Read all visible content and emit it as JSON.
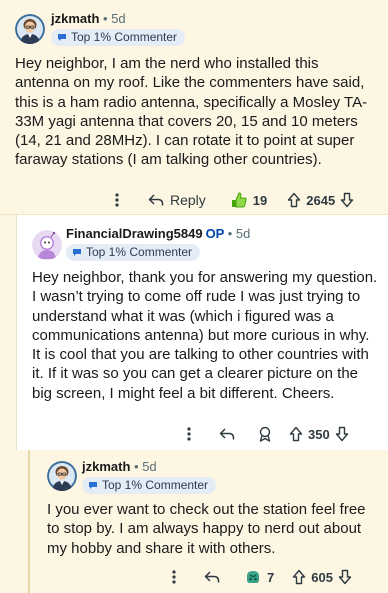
{
  "comments": [
    {
      "author": "jzkmath",
      "age": "• 5d",
      "flair": "Top 1% Commenter",
      "body": "Hey neighbor, I am the nerd who installed this antenna on my roof. Like the commenters have said, this is a ham radio antenna, specifically a Mosley TA-33M yagi antenna that covers 20, 15 and 10 meters (14, 21 and 28MHz). I can rotate it to point at super faraway stations (I am talking other countries).",
      "reply_label": "Reply",
      "award_count": "19",
      "score": "2645"
    },
    {
      "author": "FinancialDrawing5849",
      "op_badge": "OP",
      "age": "• 5d",
      "flair": "Top 1% Commenter",
      "body": "Hey neighbor, thank you for answering my question. I wasn’t trying to come off rude I was just trying to understand what it was (which i figured was a communications antenna) but more curious in why. It is cool that you are talking to other countries with it. If it was so you can get a clearer picture on the big screen, I might feel a bit different. Cheers.",
      "score": "350"
    },
    {
      "author": "jzkmath",
      "age": "• 5d",
      "flair": "Top 1% Commenter",
      "body": "I you ever want to check out the station feel free to stop by. I am always happy to nerd out about my hobby and share it with others.",
      "award_count": "7",
      "score": "605"
    }
  ],
  "icons": {
    "more": "more-dots-icon",
    "reply": "reply-arrow-icon",
    "award": "award-icon",
    "upvote": "upvote-arrow-icon",
    "downvote": "downvote-arrow-icon",
    "flair": "comment-bubble-icon"
  },
  "colors": {
    "highlight_bg": "#fcf6e3",
    "flair_bg": "#e4ecf5",
    "op_blue": "#0045ac",
    "award_green": "#46a508"
  }
}
